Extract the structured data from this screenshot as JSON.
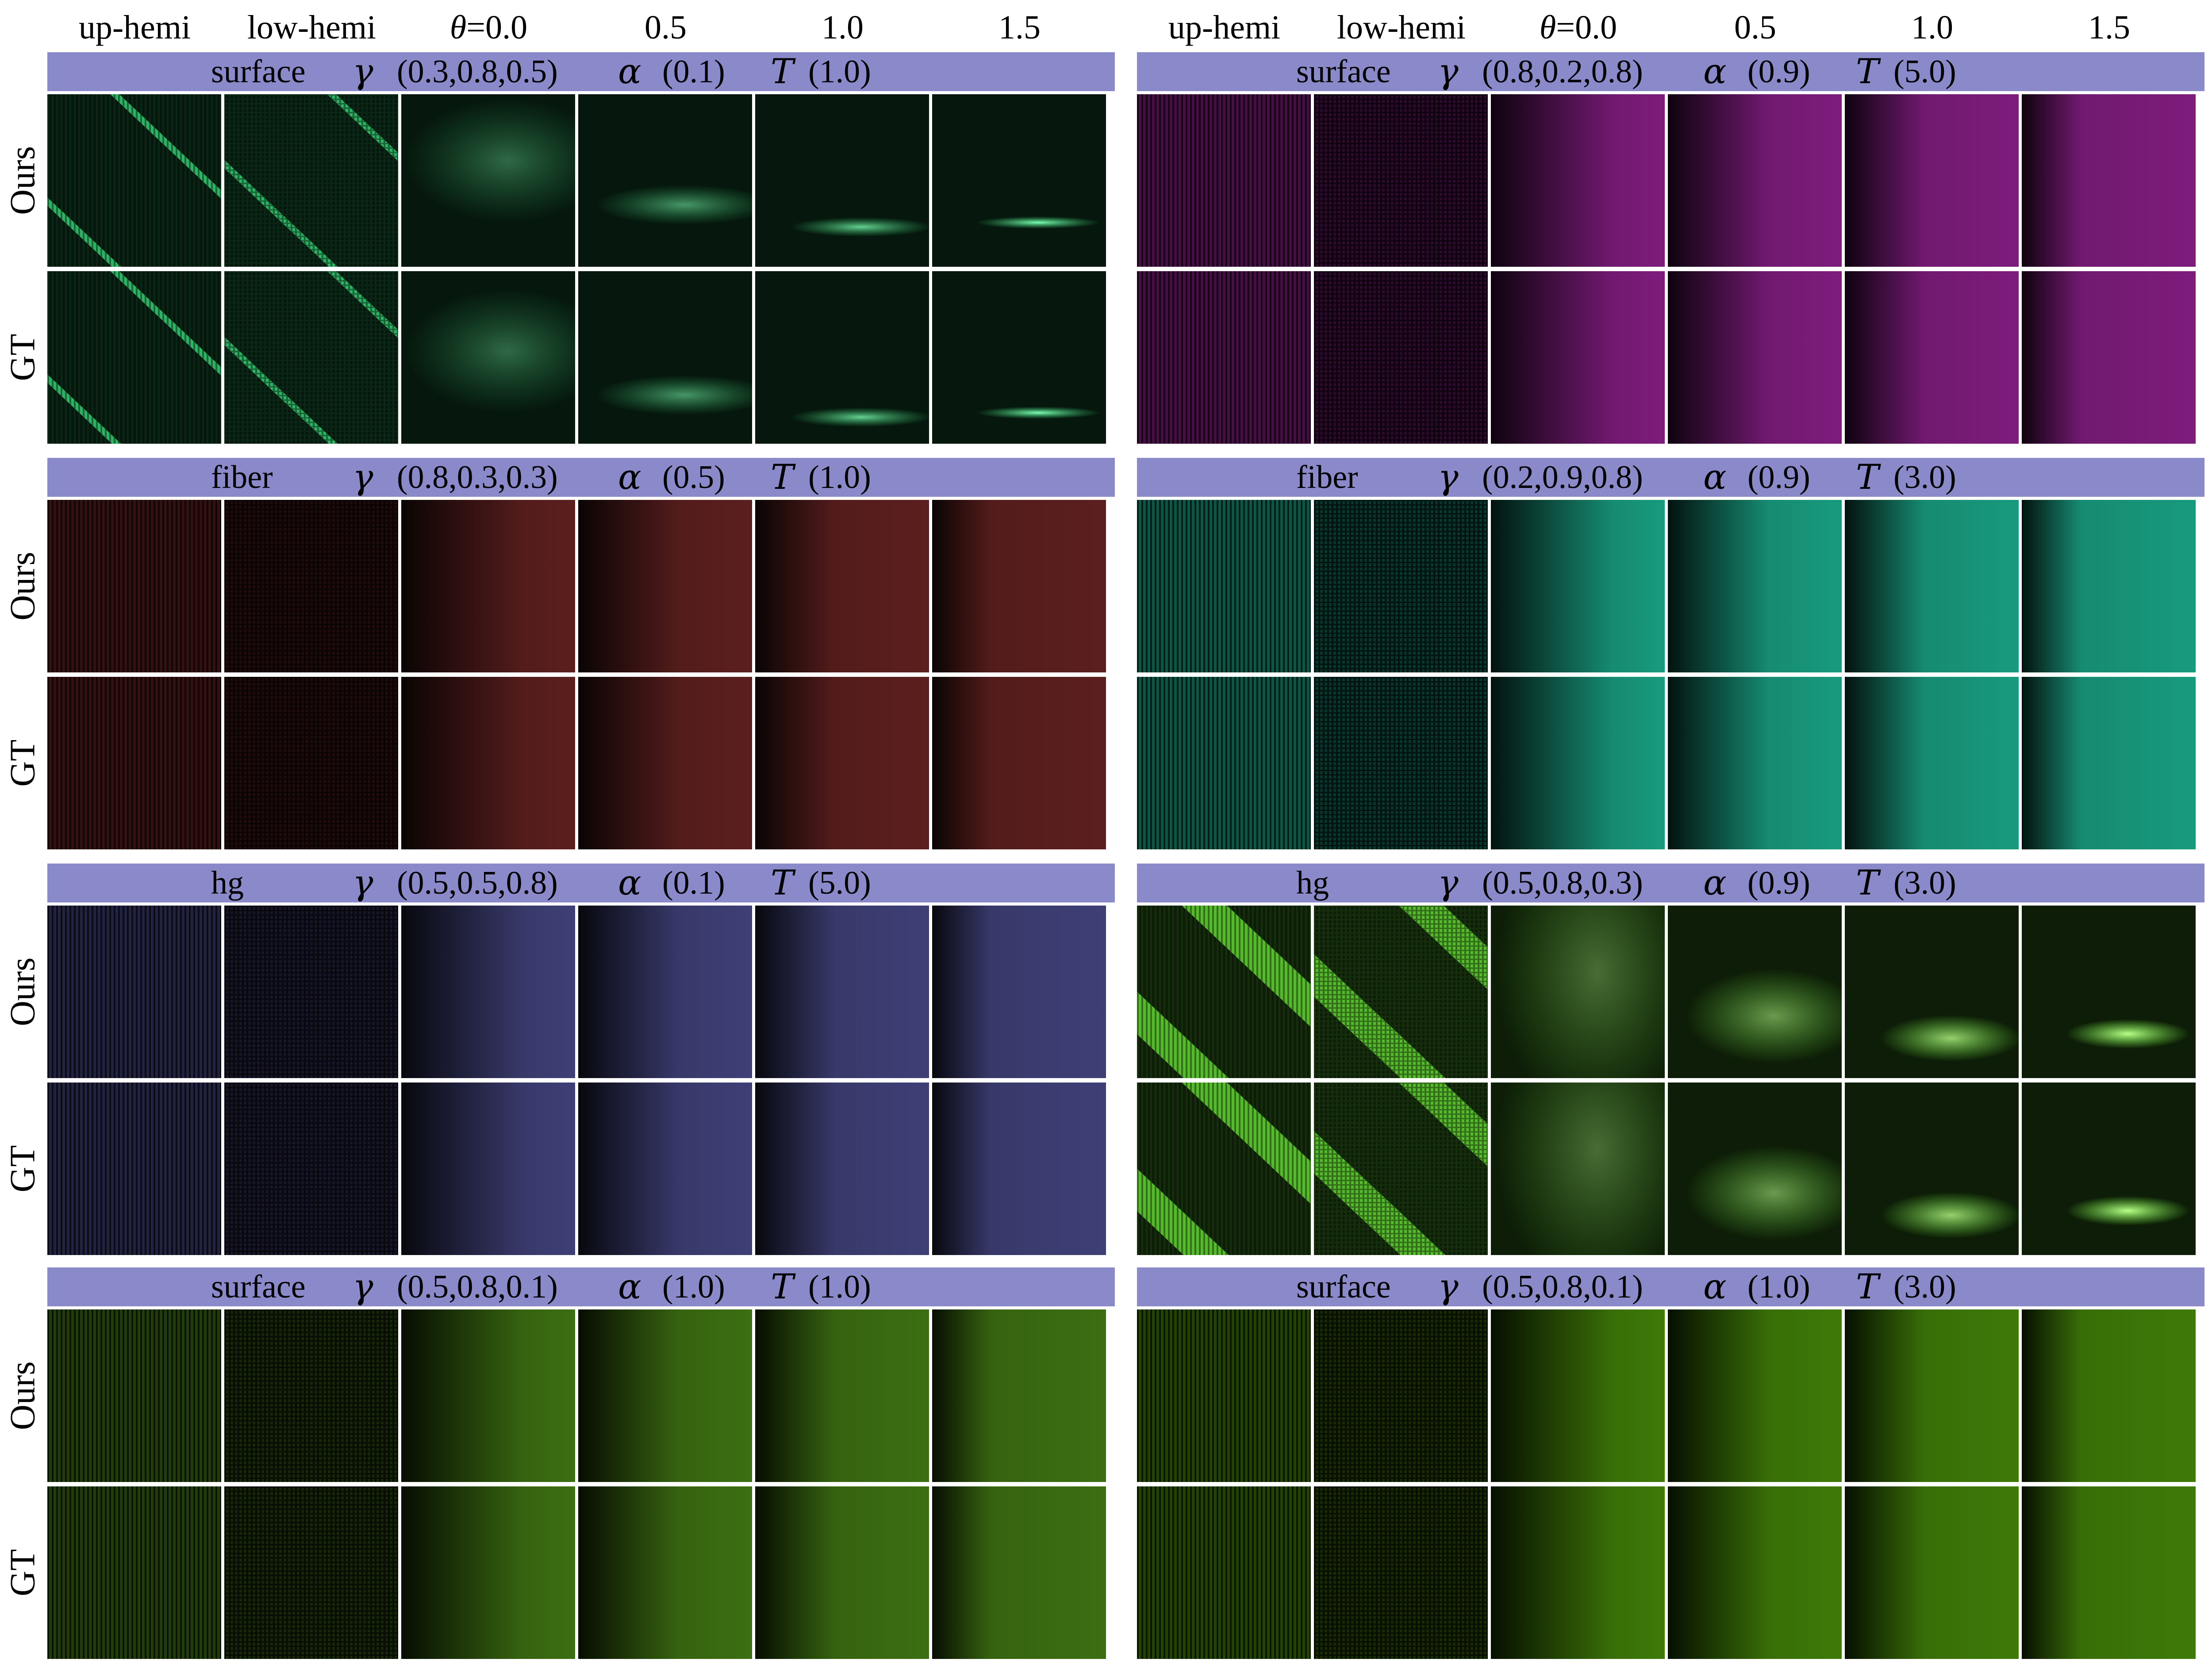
{
  "column_headers": [
    {
      "label": "up-hemi"
    },
    {
      "label": "low-hemi"
    },
    {
      "theta_symbol": "θ",
      "label": "=0.0"
    },
    {
      "label": "0.5"
    },
    {
      "label": "1.0"
    },
    {
      "label": "1.5"
    }
  ],
  "row_labels": {
    "ours": "Ours",
    "gt": "GT"
  },
  "symbols": {
    "gamma": "γ",
    "alpha": "α",
    "T": "T"
  },
  "groups": [
    {
      "panel": "left",
      "type": "surface",
      "gamma": "(0.3,0.8,0.5)",
      "alpha": "(0.1)",
      "T": "(1.0)",
      "color": "#33c46e",
      "style": "spec1"
    },
    {
      "panel": "right",
      "type": "surface",
      "gamma": "(0.8,0.2,0.8)",
      "alpha": "(0.9)",
      "T": "(5.0)",
      "color": "#7e1c7c",
      "style": "grad"
    },
    {
      "panel": "left",
      "type": "fiber",
      "gamma": "(0.8,0.3,0.3)",
      "alpha": "(0.5)",
      "T": "(1.0)",
      "color": "#5c1f1e",
      "style": "grad"
    },
    {
      "panel": "right",
      "type": "fiber",
      "gamma": "(0.2,0.9,0.8)",
      "alpha": "(0.9)",
      "T": "(3.0)",
      "color": "#189a7e",
      "style": "grad"
    },
    {
      "panel": "left",
      "type": "hg",
      "gamma": "(0.5,0.5,0.8)",
      "alpha": "(0.1)",
      "T": "(5.0)",
      "color": "#3e3f76",
      "style": "grad"
    },
    {
      "panel": "right",
      "type": "hg",
      "gamma": "(0.5,0.8,0.3)",
      "alpha": "(0.9)",
      "T": "(3.0)",
      "color": "#6ef03a",
      "style": "spec2"
    },
    {
      "panel": "left",
      "type": "surface",
      "gamma": "(0.5,0.8,0.1)",
      "alpha": "(1.0)",
      "T": "(1.0)",
      "color": "#3c6e12",
      "style": "grad"
    },
    {
      "panel": "right",
      "type": "surface",
      "gamma": "(0.5,0.8,0.1)",
      "alpha": "(1.0)",
      "T": "(3.0)",
      "color": "#3e7a08",
      "style": "grad"
    }
  ]
}
